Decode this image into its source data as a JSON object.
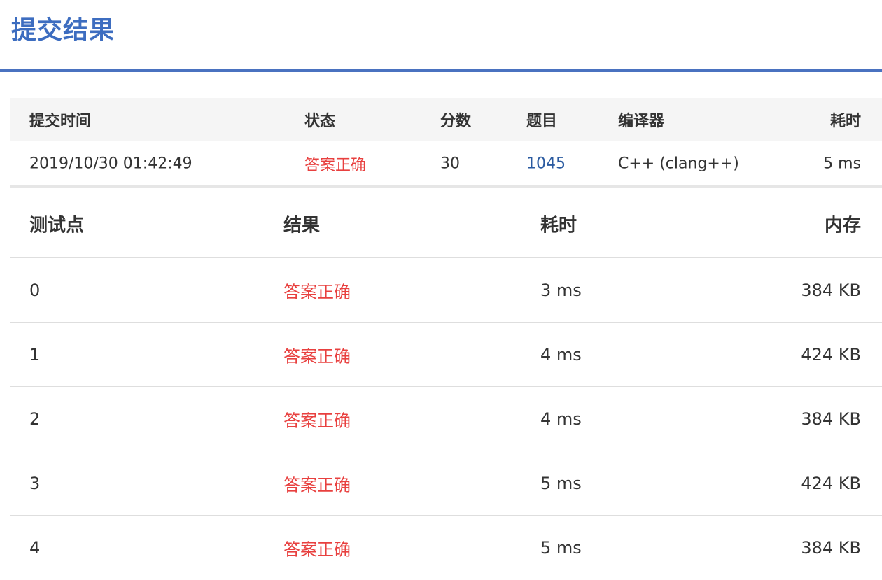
{
  "page": {
    "title": "提交结果"
  },
  "summary": {
    "headers": {
      "submit_time": "提交时间",
      "status": "状态",
      "score": "分数",
      "problem": "题目",
      "compiler": "编译器",
      "elapsed": "耗时"
    },
    "row": {
      "submit_time": "2019/10/30 01:42:49",
      "status": "答案正确",
      "score": "30",
      "problem": "1045",
      "compiler": "C++ (clang++)",
      "elapsed": "5 ms"
    }
  },
  "cases": {
    "headers": {
      "id": "测试点",
      "result": "结果",
      "time": "耗时",
      "memory": "内存"
    },
    "rows": [
      {
        "id": "0",
        "result": "答案正确",
        "time": "3 ms",
        "memory": "384 KB"
      },
      {
        "id": "1",
        "result": "答案正确",
        "time": "4 ms",
        "memory": "424 KB"
      },
      {
        "id": "2",
        "result": "答案正确",
        "time": "4 ms",
        "memory": "384 KB"
      },
      {
        "id": "3",
        "result": "答案正确",
        "time": "5 ms",
        "memory": "424 KB"
      },
      {
        "id": "4",
        "result": "答案正确",
        "time": "5 ms",
        "memory": "384 KB"
      }
    ]
  },
  "colors": {
    "title": "#3d6dc0",
    "accepted": "#e8403f",
    "link": "#2a5aa0"
  }
}
